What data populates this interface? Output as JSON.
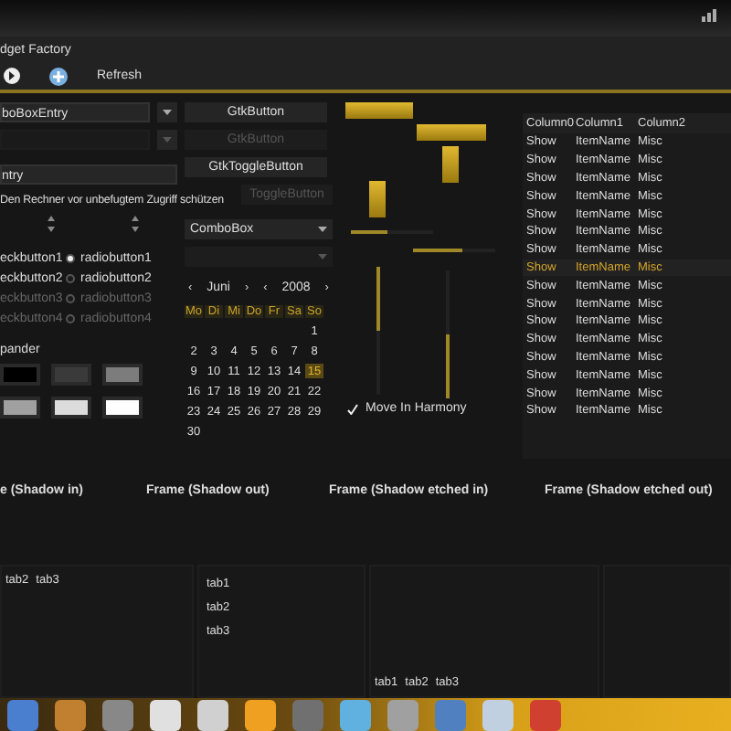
{
  "window": {
    "title": "dget Factory"
  },
  "toolbar": {
    "refresh_label": "Refresh"
  },
  "combo_entries": [
    {
      "value": "boBoxEntry",
      "disabled": false
    },
    {
      "disabled": true
    }
  ],
  "entry": {
    "value": "ntry"
  },
  "label": "Den Rechner vor unbefugtem Zugriff schützen",
  "checkbuttons": [
    {
      "label": "eckbutton1",
      "disabled": false
    },
    {
      "label": "eckbutton2",
      "disabled": false
    },
    {
      "label": "eckbutton3",
      "disabled": true
    },
    {
      "label": "eckbutton4",
      "disabled": true
    }
  ],
  "radiobuttons": [
    {
      "label": "radiobutton1",
      "selected": true,
      "disabled": false
    },
    {
      "label": "radiobutton2",
      "selected": false,
      "disabled": false
    },
    {
      "label": "radiobutton3",
      "selected": false,
      "disabled": true
    },
    {
      "label": "radiobutton4",
      "selected": false,
      "disabled": true
    }
  ],
  "expander": {
    "label": "pander"
  },
  "color_buttons": [
    {
      "color": "#000000"
    },
    {
      "color": "#3a3a3a"
    },
    {
      "color": "#7c7c7c"
    },
    {
      "color": "#a0a0a0"
    },
    {
      "color": "#dcdcdc"
    },
    {
      "color": "#ffffff"
    }
  ],
  "buttons": [
    {
      "label": "GtkButton",
      "disabled": false
    },
    {
      "label": "GtkButton",
      "disabled": true
    },
    {
      "label": "GtkToggleButton",
      "disabled": false
    },
    {
      "label": "ToggleButton",
      "disabled": true
    }
  ],
  "comboboxes": [
    {
      "value": "ComboBox",
      "disabled": false
    },
    {
      "disabled": true
    }
  ],
  "calendar": {
    "month": "Juni",
    "year": "2008",
    "prev": "‹",
    "next": "›",
    "weekdays": [
      "Mo",
      "Di",
      "Mi",
      "Do",
      "Fr",
      "Sa",
      "So"
    ],
    "weeks": [
      [
        {
          "day": "1",
          "selected": false
        }
      ],
      [
        {
          "day": "2",
          "selected": false
        },
        {
          "day": "3",
          "selected": false
        },
        {
          "day": "4",
          "selected": false
        },
        {
          "day": "5",
          "selected": false
        },
        {
          "day": "6",
          "selected": false
        },
        {
          "day": "7",
          "selected": false
        },
        {
          "day": "8",
          "selected": false
        }
      ],
      [
        {
          "day": "9",
          "selected": false
        },
        {
          "day": "10",
          "selected": false
        },
        {
          "day": "11",
          "selected": false
        },
        {
          "day": "12",
          "selected": false
        },
        {
          "day": "13",
          "selected": false
        },
        {
          "day": "14",
          "selected": false
        },
        {
          "day": "15",
          "selected": true
        }
      ],
      [
        {
          "day": "16",
          "selected": false
        },
        {
          "day": "17",
          "selected": false
        },
        {
          "day": "18",
          "selected": false
        },
        {
          "day": "19",
          "selected": false
        },
        {
          "day": "20",
          "selected": false
        },
        {
          "day": "21",
          "selected": false
        },
        {
          "day": "22",
          "selected": false
        }
      ],
      [
        {
          "day": "23",
          "selected": false
        },
        {
          "day": "24",
          "selected": false
        },
        {
          "day": "25",
          "selected": false
        },
        {
          "day": "26",
          "selected": false
        },
        {
          "day": "27",
          "selected": false
        },
        {
          "day": "28",
          "selected": false
        },
        {
          "day": "29",
          "selected": false
        }
      ],
      [
        {
          "day": "30",
          "selected": false
        }
      ]
    ]
  },
  "scales": [
    {
      "kind": "horizontal",
      "level": 0.45
    },
    {
      "kind": "horizontal",
      "level": 0.6
    },
    {
      "kind": "vertical",
      "level": 0.5
    },
    {
      "kind": "vertical",
      "level": 0.5
    }
  ],
  "harmony": {
    "label": "Move In Harmony",
    "checked": true
  },
  "tree": {
    "columns": [
      "Column0",
      "Column1",
      "Column2"
    ],
    "rows": [
      {
        "cells": [
          "Show",
          "ItemName",
          "Misc"
        ],
        "selected": false
      },
      {
        "cells": [
          "Show",
          "ItemName",
          "Misc"
        ],
        "selected": false
      },
      {
        "cells": [
          "Show",
          "ItemName",
          "Misc"
        ],
        "selected": false
      },
      {
        "cells": [
          "Show",
          "ItemName",
          "Misc"
        ],
        "selected": false
      },
      {
        "cells": [
          "Show",
          "ItemName",
          "Misc"
        ],
        "selected": false
      },
      {
        "cells": [
          "Show",
          "ItemName",
          "Misc"
        ],
        "selected": false
      },
      {
        "cells": [
          "Show",
          "ItemName",
          "Misc"
        ],
        "selected": false
      },
      {
        "cells": [
          "Show",
          "ItemName",
          "Misc"
        ],
        "selected": true
      },
      {
        "cells": [
          "Show",
          "ItemName",
          "Misc"
        ],
        "selected": false
      },
      {
        "cells": [
          "Show",
          "ItemName",
          "Misc"
        ],
        "selected": false
      },
      {
        "cells": [
          "Show",
          "ItemName",
          "Misc"
        ],
        "selected": false
      },
      {
        "cells": [
          "Show",
          "ItemName",
          "Misc"
        ],
        "selected": false
      },
      {
        "cells": [
          "Show",
          "ItemName",
          "Misc"
        ],
        "selected": false
      },
      {
        "cells": [
          "Show",
          "ItemName",
          "Misc"
        ],
        "selected": false
      },
      {
        "cells": [
          "Show",
          "ItemName",
          "Misc"
        ],
        "selected": false
      },
      {
        "cells": [
          "Show",
          "ItemName",
          "Misc"
        ],
        "selected": false
      }
    ]
  },
  "frames": [
    "e (Shadow in)",
    "Frame (Shadow out)",
    "Frame (Shadow etched in)",
    "Frame (Shadow etched out)"
  ],
  "notebooks": [
    {
      "kind": "top",
      "tabs": [
        "tab2",
        "tab3"
      ]
    },
    {
      "kind": "left",
      "tabs": [
        "tab1",
        "tab2",
        "tab3"
      ]
    },
    {
      "kind": "bottom",
      "tabs": [
        "tab1",
        "tab2",
        "tab3"
      ]
    },
    {
      "kind": "empty"
    }
  ]
}
